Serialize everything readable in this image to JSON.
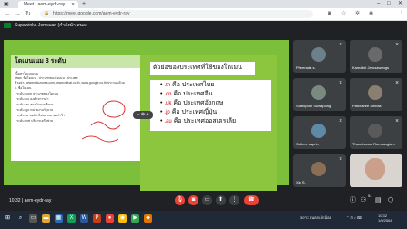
{
  "browser": {
    "tab_title": "Meet - aem-eydr-ray",
    "url": "https://meet.google.com/aem-eydr-ray"
  },
  "meet": {
    "presenter_label": "Supawinka Jomsuan (กำลังนำเสนอ)",
    "meeting_time": "10:32",
    "meeting_code": "aem-eydr-ray"
  },
  "slide_left": {
    "title": "โดเมนเนม 3 ระดับ",
    "lines": [
      "เนื้อหาโดเมนเนม",
      "www. ชื่อโดเมน . ประเภทของโดเมน . ประเทศ",
      "ตัวอย่าง www.eduzones.com, www.mthai.co.th, www.google.co.th ประกอบด้วย",
      "1. ชื่อโดเมน",
      "  • ระดับ .com ประเภทของโดเมน",
      "  • ระดับ .co องค์กรการค้า",
      "  • ระดับ .ac สถาบันการศึกษา",
      "  • ระดับ .go หน่วยงานรัฐบาล",
      "  • ระดับ .or องค์กรไม่แสวงหาผลกำไร",
      "  • ระดับ .net บริการเครือข่าย"
    ]
  },
  "slide_right": {
    "title": "ตัวย่อของประเทศที่ใช้ของโดเมน",
    "items": [
      {
        "code": ".th",
        "text": "คือ ประเทศไทย"
      },
      {
        "code": ".cn",
        "text": "คือ ประเทศจีน"
      },
      {
        "code": ".uk",
        "text": "คือ ประเทศอังกฤษ"
      },
      {
        "code": ".jp",
        "text": "คือ ประเทศญี่ปุ่น"
      },
      {
        "code": ".au",
        "text": "คือ ประเทศออสเตรเลีย"
      }
    ]
  },
  "participants": [
    {
      "name": "Pheerada s.",
      "color": "#6d7f8a"
    },
    {
      "name": "Kamolkit Jarusawongs",
      "color": "#6a6a6a"
    },
    {
      "name": "Sutthiporn Suwapong",
      "color": "#7a8a80"
    },
    {
      "name": "Patcharee Sirinak",
      "color": "#8a7f70"
    },
    {
      "name": "Suthee saprin",
      "color": "#5e8aa8"
    },
    {
      "name": "Thanchanok Romsangiam",
      "color": "#5a5a5a"
    },
    {
      "name": "Xin S.",
      "color": "#8a6e55"
    },
    {
      "name": "",
      "color": "#caa08a"
    }
  ],
  "participant_count": "54",
  "taskbar": {
    "weather": "30°C ฝนตกเล็กน้อย",
    "time": "10:32",
    "date": "1/9/2564"
  }
}
